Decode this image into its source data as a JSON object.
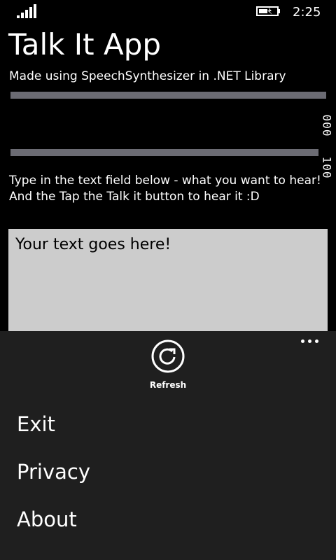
{
  "status": {
    "time": "2:25"
  },
  "app": {
    "title": "Talk It App",
    "subtitle": "Made using SpeechSynthesizer in .NET Library"
  },
  "sliders": {
    "top_value_label": "000",
    "bottom_value_label": "100"
  },
  "instructions": {
    "line1": "Type in the text field below - what you want to hear!",
    "line2": "And the Tap the Talk it button to hear it :D"
  },
  "text_field": {
    "value": "Your text goes here!"
  },
  "app_bar": {
    "refresh_label": "Refresh",
    "menu": [
      "Exit",
      "Privacy",
      "About"
    ]
  },
  "colors": {
    "background": "#000000",
    "app_bar": "#1f1f1f",
    "text_box": "#cccccc",
    "track": "#6b6b73"
  }
}
